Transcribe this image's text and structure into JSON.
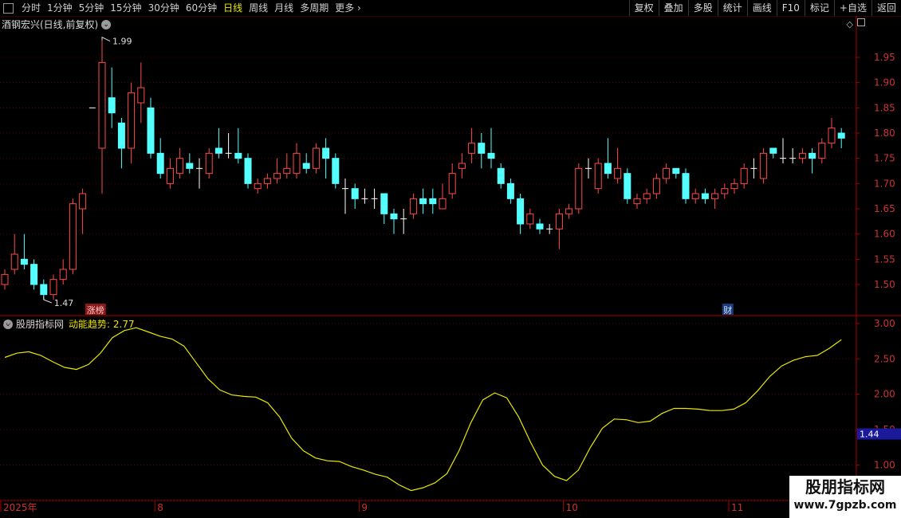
{
  "toolbar": {
    "periods": [
      {
        "label": "分时",
        "active": false
      },
      {
        "label": "1分钟",
        "active": false
      },
      {
        "label": "5分钟",
        "active": false
      },
      {
        "label": "15分钟",
        "active": false
      },
      {
        "label": "30分钟",
        "active": false
      },
      {
        "label": "60分钟",
        "active": false
      },
      {
        "label": "日线",
        "active": true
      },
      {
        "label": "周线",
        "active": false
      },
      {
        "label": "月线",
        "active": false
      },
      {
        "label": "多周期",
        "active": false
      },
      {
        "label": "更多",
        "active": false
      }
    ],
    "right_buttons": [
      "复权",
      "叠加",
      "多股",
      "统计",
      "画线",
      "F10",
      "标记",
      "+自选",
      "返回"
    ]
  },
  "stock": {
    "title": "酒钢宏兴(日线,前复权)"
  },
  "price_axis": {
    "min": 1.44,
    "max": 2.01,
    "ticks": [
      "1.95",
      "1.90",
      "1.85",
      "1.80",
      "1.75",
      "1.70",
      "1.65",
      "1.60",
      "1.55",
      "1.50"
    ]
  },
  "indicator": {
    "name": "股朋指标网",
    "line_label": "动能趋势: 2.77",
    "min": 0.5,
    "max": 3.1,
    "ticks": [
      "3.00",
      "2.50",
      "2.00",
      "1.50",
      "1.00",
      "0.50"
    ],
    "current": "1.44"
  },
  "time_axis": {
    "labels": [
      {
        "text": "2025年",
        "i": 0
      },
      {
        "text": "8",
        "i": 16
      },
      {
        "text": "9",
        "i": 37
      },
      {
        "text": "10",
        "i": 58
      },
      {
        "text": "11",
        "i": 75
      }
    ]
  },
  "annotations": {
    "high_label": "1.99",
    "low_label": "1.47",
    "markers": [
      {
        "text": "涨榜",
        "i": 9,
        "bg": "#8a1a1a",
        "color": "#ffc8c8"
      },
      {
        "text": "财",
        "i": 74,
        "bg": "#1a3c7a",
        "color": "#cfe0ff"
      }
    ]
  },
  "colors": {
    "up": "#ff4a4a",
    "down": "#54ffff",
    "grid": "#5a0000",
    "axis": "#aa0000",
    "ind_line": "#e8e800",
    "cross": "#ffffff",
    "ind_box": "#1a1a9a"
  },
  "watermark": {
    "name": "股朋指标网",
    "url": "www.7gpzb.com"
  },
  "chart_data": {
    "type": "candlestick",
    "candles": [
      [
        1.5,
        1.52,
        1.53,
        1.49
      ],
      [
        1.53,
        1.56,
        1.6,
        1.52
      ],
      [
        1.55,
        1.54,
        1.6,
        1.53
      ],
      [
        1.54,
        1.5,
        1.55,
        1.49
      ],
      [
        1.5,
        1.48,
        1.51,
        1.47
      ],
      [
        1.48,
        1.51,
        1.52,
        1.47
      ],
      [
        1.51,
        1.53,
        1.55,
        1.5
      ],
      [
        1.53,
        1.66,
        1.67,
        1.52
      ],
      [
        1.65,
        1.68,
        1.69,
        1.6
      ],
      [
        1.85,
        1.85,
        1.85,
        1.85
      ],
      [
        1.77,
        1.94,
        1.99,
        1.68
      ],
      [
        1.87,
        1.84,
        1.93,
        1.81
      ],
      [
        1.82,
        1.77,
        1.83,
        1.73
      ],
      [
        1.77,
        1.88,
        1.9,
        1.74
      ],
      [
        1.86,
        1.89,
        1.94,
        1.82
      ],
      [
        1.85,
        1.76,
        1.87,
        1.75
      ],
      [
        1.76,
        1.72,
        1.79,
        1.71
      ],
      [
        1.7,
        1.73,
        1.75,
        1.69
      ],
      [
        1.72,
        1.75,
        1.77,
        1.71
      ],
      [
        1.74,
        1.73,
        1.76,
        1.72
      ],
      [
        1.73,
        1.73,
        1.75,
        1.69
      ],
      [
        1.72,
        1.76,
        1.77,
        1.71
      ],
      [
        1.77,
        1.76,
        1.81,
        1.75
      ],
      [
        1.76,
        1.76,
        1.8,
        1.75
      ],
      [
        1.76,
        1.75,
        1.81,
        1.74
      ],
      [
        1.75,
        1.7,
        1.76,
        1.69
      ],
      [
        1.69,
        1.7,
        1.71,
        1.68
      ],
      [
        1.7,
        1.71,
        1.72,
        1.69
      ],
      [
        1.71,
        1.72,
        1.75,
        1.7
      ],
      [
        1.72,
        1.73,
        1.76,
        1.71
      ],
      [
        1.72,
        1.76,
        1.78,
        1.71
      ],
      [
        1.74,
        1.73,
        1.76,
        1.72
      ],
      [
        1.73,
        1.77,
        1.78,
        1.72
      ],
      [
        1.77,
        1.75,
        1.79,
        1.71
      ],
      [
        1.75,
        1.7,
        1.76,
        1.69
      ],
      [
        1.69,
        1.69,
        1.71,
        1.64
      ],
      [
        1.69,
        1.67,
        1.7,
        1.65
      ],
      [
        1.67,
        1.67,
        1.69,
        1.66
      ],
      [
        1.67,
        1.67,
        1.69,
        1.65
      ],
      [
        1.68,
        1.64,
        1.68,
        1.62
      ],
      [
        1.64,
        1.63,
        1.65,
        1.6
      ],
      [
        1.63,
        1.63,
        1.65,
        1.6
      ],
      [
        1.64,
        1.67,
        1.68,
        1.63
      ],
      [
        1.67,
        1.66,
        1.69,
        1.64
      ],
      [
        1.67,
        1.66,
        1.69,
        1.64
      ],
      [
        1.65,
        1.67,
        1.7,
        1.65
      ],
      [
        1.68,
        1.72,
        1.74,
        1.67
      ],
      [
        1.73,
        1.74,
        1.76,
        1.71
      ],
      [
        1.76,
        1.78,
        1.81,
        1.74
      ],
      [
        1.78,
        1.76,
        1.8,
        1.73
      ],
      [
        1.76,
        1.75,
        1.81,
        1.73
      ],
      [
        1.73,
        1.7,
        1.74,
        1.69
      ],
      [
        1.7,
        1.67,
        1.71,
        1.66
      ],
      [
        1.67,
        1.62,
        1.68,
        1.6
      ],
      [
        1.62,
        1.64,
        1.65,
        1.61
      ],
      [
        1.62,
        1.61,
        1.63,
        1.6
      ],
      [
        1.61,
        1.61,
        1.62,
        1.6
      ],
      [
        1.61,
        1.64,
        1.65,
        1.57
      ],
      [
        1.64,
        1.65,
        1.66,
        1.63
      ],
      [
        1.65,
        1.73,
        1.74,
        1.64
      ],
      [
        1.73,
        1.73,
        1.75,
        1.71
      ],
      [
        1.69,
        1.74,
        1.75,
        1.68
      ],
      [
        1.74,
        1.72,
        1.79,
        1.71
      ],
      [
        1.71,
        1.73,
        1.77,
        1.7
      ],
      [
        1.72,
        1.67,
        1.73,
        1.66
      ],
      [
        1.66,
        1.67,
        1.68,
        1.65
      ],
      [
        1.67,
        1.68,
        1.69,
        1.66
      ],
      [
        1.68,
        1.71,
        1.72,
        1.67
      ],
      [
        1.71,
        1.73,
        1.74,
        1.7
      ],
      [
        1.73,
        1.72,
        1.73,
        1.71
      ],
      [
        1.72,
        1.67,
        1.73,
        1.66
      ],
      [
        1.67,
        1.68,
        1.69,
        1.66
      ],
      [
        1.68,
        1.67,
        1.69,
        1.66
      ],
      [
        1.67,
        1.68,
        1.69,
        1.65
      ],
      [
        1.68,
        1.69,
        1.7,
        1.67
      ],
      [
        1.69,
        1.7,
        1.71,
        1.68
      ],
      [
        1.7,
        1.73,
        1.74,
        1.69
      ],
      [
        1.73,
        1.73,
        1.75,
        1.71
      ],
      [
        1.71,
        1.76,
        1.77,
        1.7
      ],
      [
        1.77,
        1.76,
        1.77,
        1.75
      ],
      [
        1.75,
        1.75,
        1.79,
        1.74
      ],
      [
        1.75,
        1.75,
        1.77,
        1.74
      ],
      [
        1.75,
        1.76,
        1.77,
        1.74
      ],
      [
        1.76,
        1.75,
        1.77,
        1.72
      ],
      [
        1.75,
        1.78,
        1.79,
        1.74
      ],
      [
        1.78,
        1.81,
        1.83,
        1.77
      ],
      [
        1.8,
        1.79,
        1.81,
        1.77
      ]
    ],
    "indicator_series": [
      2.52,
      2.58,
      2.6,
      2.55,
      2.46,
      2.38,
      2.35,
      2.42,
      2.58,
      2.8,
      2.9,
      2.94,
      2.88,
      2.82,
      2.78,
      2.68,
      2.45,
      2.22,
      2.06,
      1.99,
      1.97,
      1.96,
      1.88,
      1.68,
      1.38,
      1.2,
      1.1,
      1.06,
      1.05,
      0.98,
      0.93,
      0.87,
      0.83,
      0.72,
      0.64,
      0.68,
      0.75,
      0.88,
      1.2,
      1.6,
      1.92,
      2.02,
      1.95,
      1.68,
      1.32,
      1.0,
      0.84,
      0.78,
      0.93,
      1.25,
      1.52,
      1.65,
      1.64,
      1.6,
      1.62,
      1.73,
      1.8,
      1.8,
      1.79,
      1.77,
      1.77,
      1.79,
      1.88,
      2.05,
      2.25,
      2.4,
      2.48,
      2.53,
      2.55,
      2.65,
      2.77
    ]
  }
}
